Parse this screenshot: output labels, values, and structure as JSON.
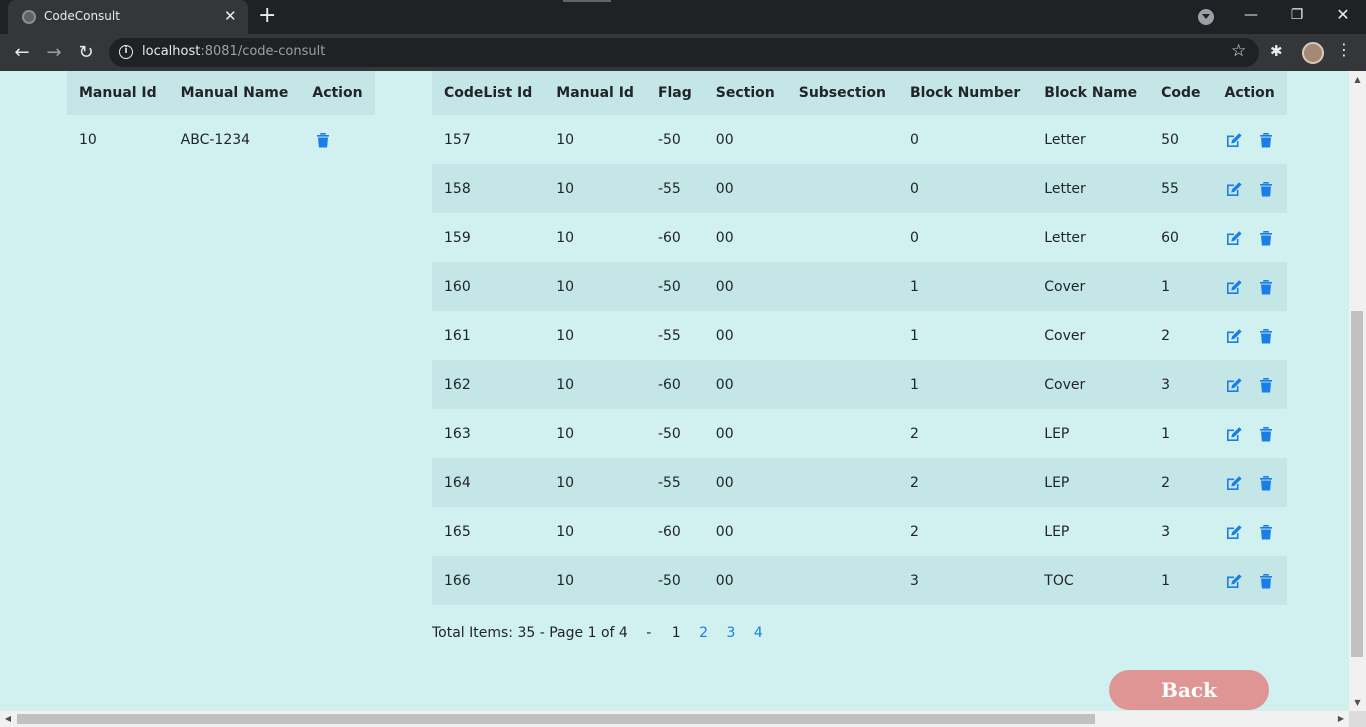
{
  "browser": {
    "tab_title": "CodeConsult",
    "tab_close": "✕",
    "new_tab": "+",
    "url_host": "localhost",
    "url_path": ":8081/code-consult",
    "window_minimize": "—",
    "window_restore": "❐",
    "window_close": "✕"
  },
  "manuals_table": {
    "headers": [
      "Manual Id",
      "Manual Name",
      "Action"
    ],
    "rows": [
      {
        "manual_id": "10",
        "manual_name": "ABC-1234"
      }
    ]
  },
  "codelist_table": {
    "headers": [
      "CodeList Id",
      "Manual Id",
      "Flag",
      "Section",
      "Subsection",
      "Block Number",
      "Block Name",
      "Code",
      "Action"
    ],
    "rows": [
      {
        "codelist_id": "157",
        "manual_id": "10",
        "flag": "-50",
        "section": "00",
        "subsection": "",
        "block_number": "0",
        "block_name": "Letter",
        "code": "50"
      },
      {
        "codelist_id": "158",
        "manual_id": "10",
        "flag": "-55",
        "section": "00",
        "subsection": "",
        "block_number": "0",
        "block_name": "Letter",
        "code": "55"
      },
      {
        "codelist_id": "159",
        "manual_id": "10",
        "flag": "-60",
        "section": "00",
        "subsection": "",
        "block_number": "0",
        "block_name": "Letter",
        "code": "60"
      },
      {
        "codelist_id": "160",
        "manual_id": "10",
        "flag": "-50",
        "section": "00",
        "subsection": "",
        "block_number": "1",
        "block_name": "Cover",
        "code": "1"
      },
      {
        "codelist_id": "161",
        "manual_id": "10",
        "flag": "-55",
        "section": "00",
        "subsection": "",
        "block_number": "1",
        "block_name": "Cover",
        "code": "2"
      },
      {
        "codelist_id": "162",
        "manual_id": "10",
        "flag": "-60",
        "section": "00",
        "subsection": "",
        "block_number": "1",
        "block_name": "Cover",
        "code": "3"
      },
      {
        "codelist_id": "163",
        "manual_id": "10",
        "flag": "-50",
        "section": "00",
        "subsection": "",
        "block_number": "2",
        "block_name": "LEP",
        "code": "1"
      },
      {
        "codelist_id": "164",
        "manual_id": "10",
        "flag": "-55",
        "section": "00",
        "subsection": "",
        "block_number": "2",
        "block_name": "LEP",
        "code": "2"
      },
      {
        "codelist_id": "165",
        "manual_id": "10",
        "flag": "-60",
        "section": "00",
        "subsection": "",
        "block_number": "2",
        "block_name": "LEP",
        "code": "3"
      },
      {
        "codelist_id": "166",
        "manual_id": "10",
        "flag": "-50",
        "section": "00",
        "subsection": "",
        "block_number": "3",
        "block_name": "TOC",
        "code": "1"
      }
    ]
  },
  "pagination": {
    "summary": "Total Items: 35 - Page 1 of 4",
    "separator": "-",
    "pages": [
      "1",
      "2",
      "3",
      "4"
    ],
    "current_page": "1"
  },
  "back_label": "Back",
  "colors": {
    "page_bg": "#d1f0f0",
    "row_alt_bg": "#c4e6e6",
    "icon_blue": "#1a7ee8",
    "back_button": "#e09595"
  },
  "icons": {
    "delete": "trash-icon",
    "edit": "edit-icon"
  }
}
